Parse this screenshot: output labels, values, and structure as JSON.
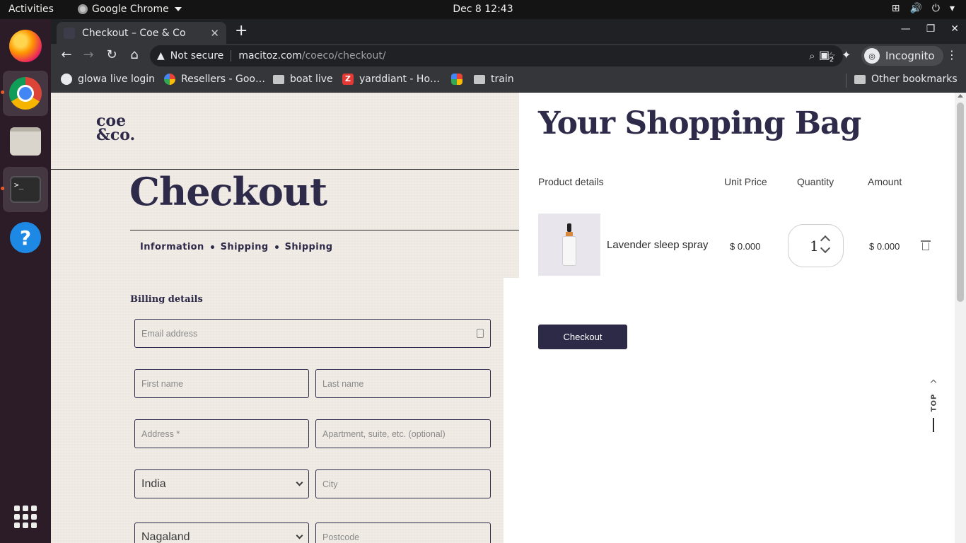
{
  "system": {
    "activities": "Activities",
    "app_name": "Google Chrome",
    "clock": "Dec 8  12:43"
  },
  "browser": {
    "tab_title": "Checkout – Coe & Co",
    "tab_close": "✕",
    "new_tab": "+",
    "url_warning": "Not secure",
    "url_host": "macitoz.com",
    "url_path": "/coeco/checkout/",
    "profile": "Incognito",
    "ext_badge": "2",
    "bookmarks": [
      "glowa live login",
      "Resellers - Goo…",
      "boat live",
      "yarddiant - Ho…",
      "train"
    ],
    "other_bookmarks": "Other bookmarks"
  },
  "checkout": {
    "logo_top": "coe",
    "logo_bottom": "&co.",
    "title": "Checkout",
    "steps": [
      "Information",
      "Shipping",
      "Shipping"
    ],
    "billing_title": "Billing details",
    "fields": {
      "email": "Email address",
      "first_name": "First name",
      "last_name": "Last name",
      "address": "Address *",
      "apartment": "Apartment, suite, etc. (optional)",
      "country": "India",
      "city": "City",
      "state": "Nagaland",
      "postcode": "Postcode"
    }
  },
  "cart": {
    "title": "Your Shopping Bag",
    "columns": {
      "product": "Product details",
      "unit_price": "Unit Price",
      "quantity": "Quantity",
      "amount": "Amount"
    },
    "items": [
      {
        "name": "Lavender sleep spray",
        "unit_price": "$ 0.000",
        "quantity": "1",
        "amount": "$ 0.000"
      }
    ],
    "checkout_button": "Checkout",
    "to_top": "TOP"
  }
}
